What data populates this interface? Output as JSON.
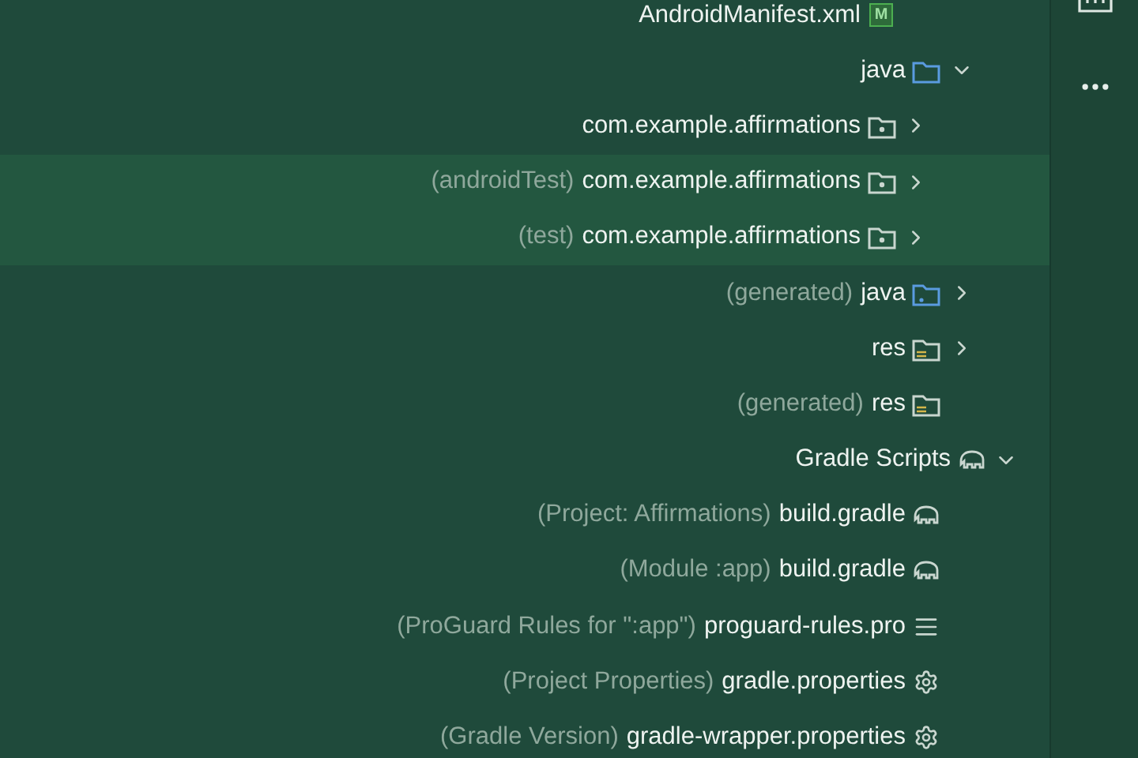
{
  "tree": [
    {
      "children": [
        {
          "children": [
            {
              "label": "AndroidManifest.xml",
              "kind": "manifest",
              "badge": "M",
              "selected": false
            }
          ]
        },
        {
          "label": "java",
          "kind": "folder",
          "expanded": true,
          "selected": false,
          "children": [
            {
              "label": "com.example.affirmations",
              "kind": "package",
              "expanded": false,
              "selected": false
            },
            {
              "label": "com.example.affirmations",
              "detail": "(androidTest)",
              "kind": "package",
              "expanded": false,
              "selected": true
            },
            {
              "label": "com.example.affirmations",
              "detail": "(test)",
              "kind": "package",
              "expanded": false,
              "selected": true
            }
          ]
        },
        {
          "label": "java",
          "detail": "(generated)",
          "kind": "generated",
          "expanded": false,
          "selected": false
        },
        {
          "label": "res",
          "kind": "res",
          "expanded": false,
          "selected": false
        },
        {
          "label": "res",
          "detail": "(generated)",
          "kind": "res",
          "selected": false
        }
      ]
    },
    {
      "label": "Gradle Scripts",
      "kind": "gradle",
      "expanded": true,
      "selected": false,
      "children": [
        {
          "label": "build.gradle",
          "detail": "(Project: Affirmations)",
          "kind": "gradle",
          "selected": false
        },
        {
          "label": "build.gradle",
          "detail": "(Module :app)",
          "kind": "gradle",
          "selected": false
        },
        {
          "label": "proguard-rules.pro",
          "detail": "(ProGuard Rules for \":app\")",
          "kind": "lines",
          "selected": false
        },
        {
          "label": "gradle.properties",
          "detail": "(Project Properties)",
          "kind": "gear",
          "selected": false
        },
        {
          "label": "gradle-wrapper.properties",
          "detail": "(Gradle Version)",
          "kind": "gear",
          "selected": false
        }
      ]
    }
  ]
}
